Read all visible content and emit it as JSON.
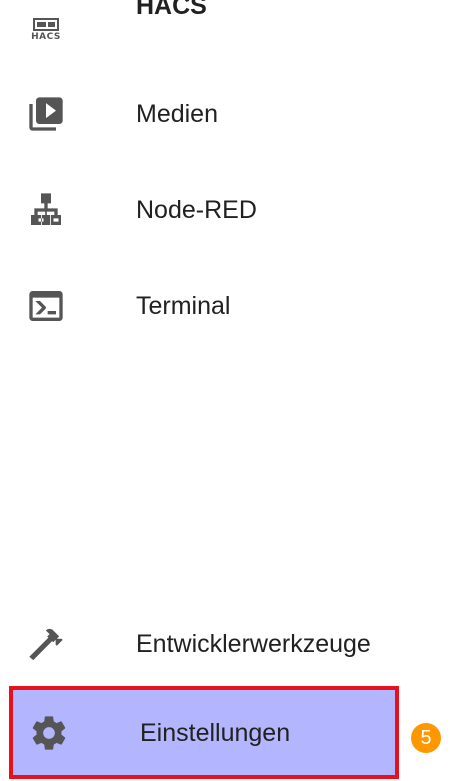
{
  "sidebar": {
    "items": [
      {
        "label": "HACS",
        "icon": "hacs-icon",
        "icon_text": "HACS"
      },
      {
        "label": "Medien",
        "icon": "media-play-icon"
      },
      {
        "label": "Node-RED",
        "icon": "sitemap-icon"
      },
      {
        "label": "Terminal",
        "icon": "console-icon"
      },
      {
        "label": "Entwicklerwerkzeuge",
        "icon": "hammer-icon"
      },
      {
        "label": "Einstellungen",
        "icon": "gear-icon",
        "selected": true
      }
    ],
    "notification_badge": "5"
  },
  "colors": {
    "selected_background": "#b4b5ff",
    "highlight_border": "#e8101c",
    "badge": "#ff9800",
    "icon": "#555555",
    "text": "#212121"
  }
}
